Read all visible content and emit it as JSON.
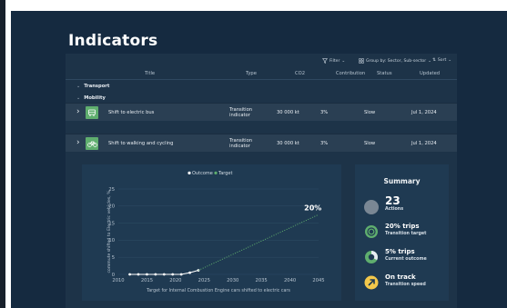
{
  "page": {
    "title": "Indicators"
  },
  "toolbar": {
    "filter_label": "Filter",
    "group_label": "Group by: Sector, Sub-sector",
    "sort_label": "Sort"
  },
  "table": {
    "columns": [
      "Title",
      "Type",
      "CO2",
      "Contribution",
      "Status",
      "Updated"
    ],
    "groups": {
      "transport": "Transport",
      "mobility": "Mobility"
    },
    "rows": [
      {
        "title": "Shift to electric bus",
        "type": "Transition indicator",
        "co2": "30 000 kt",
        "contribution": "3%",
        "status": "Slow",
        "updated": "Jul 1, 2024",
        "icon": "bus-icon"
      },
      {
        "title": "Shift to walking and cycling",
        "type": "Transition indicator",
        "co2": "30 000 kt",
        "contribution": "3%",
        "status": "Slow",
        "updated": "Jul 1, 2024",
        "icon": "bicycle-icon"
      }
    ]
  },
  "chart_data": {
    "type": "line",
    "legend": [
      "Outcome",
      "Target"
    ],
    "legend_placement": "top-center",
    "ylabel": "commute shifted to Electric vehicles, %",
    "xlabel": "Target for Internal Combustion Engine cars shifted to electric cars",
    "xlim": [
      2010,
      2045
    ],
    "ylim": [
      0,
      25
    ],
    "xticks": [
      "2010",
      "2015",
      "2020",
      "2025",
      "2030",
      "2035",
      "2040",
      "2045"
    ],
    "yticks": [
      "0",
      "5",
      "10",
      "15",
      "20",
      "25"
    ],
    "grid": true,
    "series": [
      {
        "name": "Outcome",
        "color": "#ffffff",
        "style": "solid",
        "markers": true,
        "x": [
          2012,
          2013.5,
          2015,
          2016.5,
          2018,
          2019.5,
          2021,
          2022.5,
          2024
        ],
        "y": [
          0,
          0,
          0,
          0,
          0,
          0,
          0,
          0.5,
          1.2
        ]
      },
      {
        "name": "Target",
        "color": "#5fae6e",
        "style": "dotted",
        "markers": false,
        "x": [
          2024,
          2045
        ],
        "y": [
          1.2,
          17.5
        ]
      }
    ],
    "annotation": {
      "text": "20%",
      "x": 2044,
      "y": 19
    }
  },
  "summary": {
    "title": "Summary",
    "items": [
      {
        "big": "23",
        "sub": "Actions",
        "icon": "circle-icon"
      },
      {
        "big": "20% trips",
        "sub": "Transition target",
        "icon": "target-ring-icon"
      },
      {
        "big": "5% trips",
        "sub": "Current outcome",
        "icon": "pie-progress-icon"
      },
      {
        "big": "On track",
        "sub": "Transition speed",
        "icon": "arrow-up-right-icon"
      }
    ],
    "colors": {
      "accent": "#5fae6e",
      "track": "#f3c84b",
      "muted": "#7a8794"
    }
  }
}
